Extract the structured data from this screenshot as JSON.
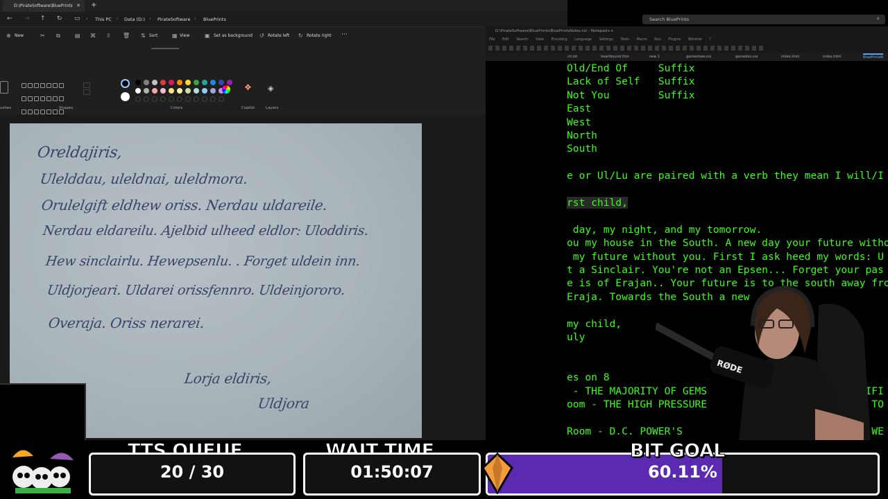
{
  "explorer": {
    "tab_title": "D:\\PirateSoftware\\BluePrints",
    "breadcrumbs": [
      "This PC",
      "Data (D:)",
      "PirateSoftware",
      "BluePrints"
    ],
    "search_placeholder": "Search BluePrints",
    "commands": {
      "new": "New",
      "sort": "Sort",
      "view": "View",
      "set_background": "Set as background",
      "rotate_left": "Rotate left",
      "rotate_right": "Rotate right",
      "more": "···"
    }
  },
  "paint": {
    "group_labels": {
      "shapes": "Shapes",
      "colors": "Colors",
      "copilot": "Copilot",
      "layers": "Layers",
      "brushes": "ushes"
    },
    "palette": [
      "#000000",
      "#7f7f7f",
      "#c3c3c3",
      "#e53935",
      "#d81b60",
      "#fb8c00",
      "#fdd835",
      "#43a047",
      "#26a69a",
      "#1e88e5",
      "#3949ab",
      "#8e24aa",
      "#ffffff",
      "#b0b0b0",
      "#f4a6a6",
      "#f8bbd0",
      "#ffe082",
      "#fff59d",
      "#c5e1a5",
      "#b2dfdb",
      "#90caf9",
      "#9fa8da",
      "#ce93d8"
    ]
  },
  "letter": {
    "lines": [
      "Oreldajiris,",
      "Ulelddau, uleldnai, uleldmora.",
      "Orulelgift eldhew oriss. Nerdau uldareile.",
      "Nerdau eldareilu. Ajelbid ulheed eldlor: Uloddiris.",
      "Hew sinclairlu. Hewepsenlu. . Forget uldein inn.",
      "Uldjorjeari. Uldarei orissfennro. Uldeinjororo.",
      "Overaja. Oriss nerarei.",
      "Lorja eldiris,",
      "Uldjora"
    ]
  },
  "notepad": {
    "title": "D:\\PirateSoftware\\BluePrints\\BluePrintsNotes.txt - Notepad++",
    "menu": [
      "File",
      "Edit",
      "Search",
      "View",
      "Encoding",
      "Language",
      "Settings",
      "Tools",
      "Macro",
      "Run",
      "Plugins",
      "Window",
      "?"
    ],
    "tabs": [
      "ch.txt",
      "heartbound.thor",
      "new 1",
      "gameshow.css",
      "gamedev.css",
      "index.html",
      "index.html",
      "BluePrintsN"
    ],
    "lines": [
      "Old/End Of     Suffix",
      "Lack of Self   Suffix",
      "Not You        Suffix",
      "East",
      "West",
      "North",
      "South",
      "",
      "e or Ul/Lu are paired with a verb they mean I will/I",
      "",
      "rst child,",
      "",
      " day, my night, and my tomorrow.",
      "ou my house in the South. A new day your future witho",
      " my future without you. First I ask heed my words: U",
      "t a Sinclair. You're not an Epsen... Forget your pas",
      "e is of Erajan.. Your future is to the south away fro",
      "Eraja. Towards the South a new",
      "",
      "my child,",
      "uly",
      "",
      "",
      "es on 8",
      " - THE MAJORITY OF GEMS                       ARTIFI",
      "oom - THE HIGH PRESSURE                      NNEL TO",
      "",
      "Room - D.C. POWER'S                      CONTROLS WE"
    ]
  },
  "overlay": {
    "tts_label": "TTS QUEUE",
    "tts_value": "20 / 30",
    "wait_label": "WAIT TIME",
    "wait_value": "01:50:07",
    "bit_label": "BIT GOAL",
    "bit_value": "60.11%",
    "bit_fraction": 0.6011,
    "bit_color": "#5a2bb0"
  },
  "webcam": {
    "mic_brand": "RØDE"
  }
}
